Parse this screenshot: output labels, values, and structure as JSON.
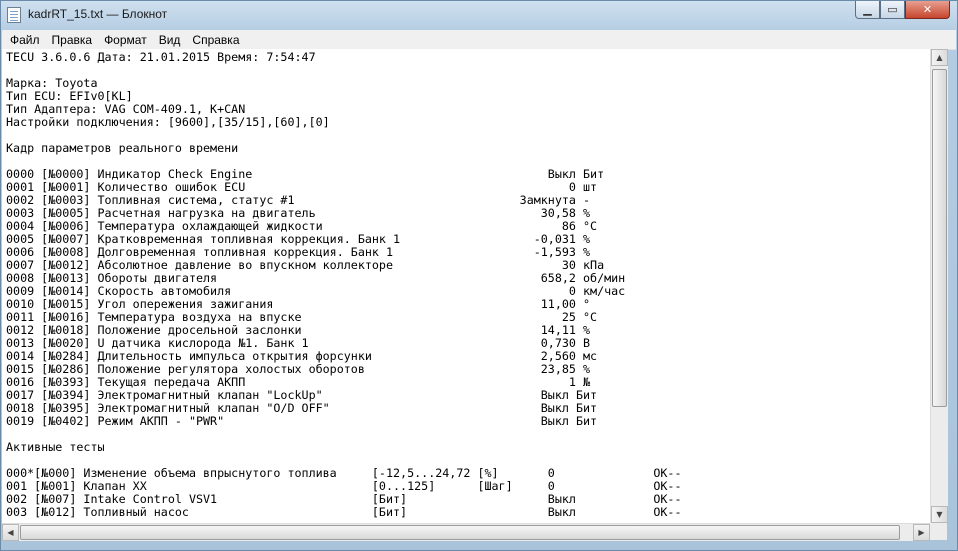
{
  "window": {
    "title": "kadrRT_15.txt — Блокнот",
    "icon": "notepad-icon",
    "controls": {
      "minimize": "minimize-icon",
      "maximize": "maximize-icon",
      "close": "close-icon"
    }
  },
  "menu": [
    "Файл",
    "Правка",
    "Формат",
    "Вид",
    "Справка"
  ],
  "document": {
    "lines": [
      "TECU 3.6.0.6 Дата: 21.01.2015 Время: 7:54:47",
      "",
      "Марка: Toyota",
      "Тип ECU: EFIv0[KL]",
      "Тип Адаптера: VAG COM-409.1, K+CAN",
      "Настройки подключения: [9600],[35/15],[60],[0]",
      "",
      "Кадр параметров реального времени",
      "",
      "0000 [№0000] Индикатор Check Engine                                          Выкл Бит",
      "0001 [№0001] Количество ошибок ECU                                              0 шт",
      "0002 [№0003] Топливная система, статус #1                                Замкнута -",
      "0003 [№0005] Расчетная нагрузка на двигатель                                30,58 %",
      "0004 [№0006] Температура охлаждающей жидкости                                  86 °C",
      "0005 [№0007] Кратковременная топливная коррекция. Банк 1                   -0,031 %",
      "0006 [№0008] Долговременная топливная коррекция. Банк 1                    -1,593 %",
      "0007 [№0012] Абсолютное давление во впускном коллекторе                        30 кПа",
      "0008 [№0013] Обороты двигателя                                              658,2 об/мин",
      "0009 [№0014] Скорость автомобиля                                                0 км/час",
      "0010 [№0015] Угол опережения зажигания                                      11,00 °",
      "0011 [№0016] Температура воздуха на впуске                                     25 °C",
      "0012 [№0018] Положение дросельной заслонки                                  14,11 %",
      "0013 [№0020] U датчика кислорода №1. Банк 1                                 0,730 В",
      "0014 [№0284] Длительность импульса открытия форсунки                        2,560 мс",
      "0015 [№0286] Положение регулятора холостых оборотов                         23,85 %",
      "0016 [№0393] Текущая передача АКПП                                              1 №",
      "0017 [№0394] Электромагнитный клапан \"LockUp\"                               Выкл Бит",
      "0018 [№0395] Электромагнитный клапан \"O/D OFF\"                              Выкл Бит",
      "0019 [№0402] Режим АКПП - \"PWR\"                                             Выкл Бит",
      "",
      "Активные тесты",
      "",
      "000*[№000] Изменение объема впрыснутого топлива     [-12,5...24,72 [%]       0              OK--",
      "001 [№001] Клапан ХХ                                [0...125]      [Шаг]     0              OK--",
      "002 [№007] Intake Control VSV1                      [Бит]                    Выкл           OK--",
      "003 [№012] Топливный насос                          [Бит]                    Выкл           OK--"
    ]
  }
}
